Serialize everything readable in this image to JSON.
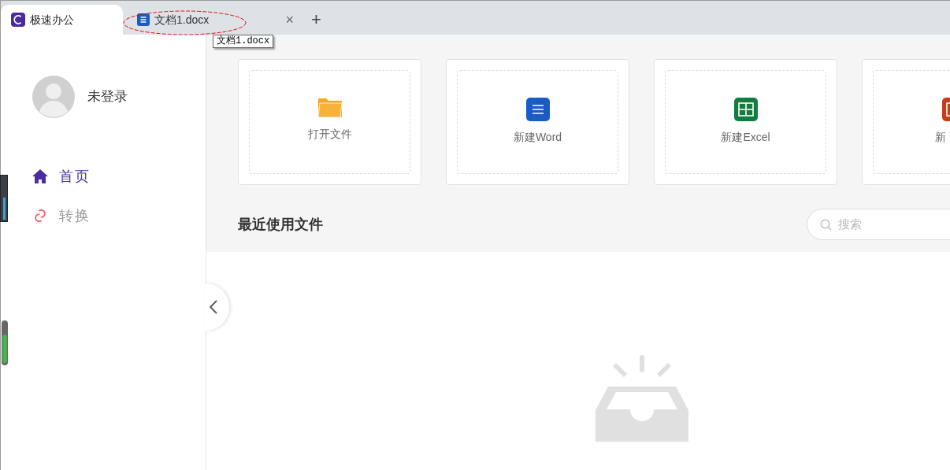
{
  "tabs": [
    {
      "title": "极速办公",
      "selected": true,
      "kind": "app"
    },
    {
      "title": "文档1.docx",
      "selected": false,
      "kind": "doc",
      "close": "×"
    }
  ],
  "new_tab": "+",
  "tooltip": "文档1.docx",
  "user": {
    "name": "未登录"
  },
  "nav": [
    {
      "label": "首页",
      "selected": true
    },
    {
      "label": "转换",
      "selected": false
    }
  ],
  "cards": [
    {
      "label": "打开文件",
      "kind": "folder"
    },
    {
      "label": "新建Word",
      "kind": "word"
    },
    {
      "label": "新建Excel",
      "kind": "excel"
    },
    {
      "label": "新",
      "kind": "ppt"
    }
  ],
  "recent": {
    "title": "最近使用文件",
    "search_placeholder": "搜索"
  }
}
